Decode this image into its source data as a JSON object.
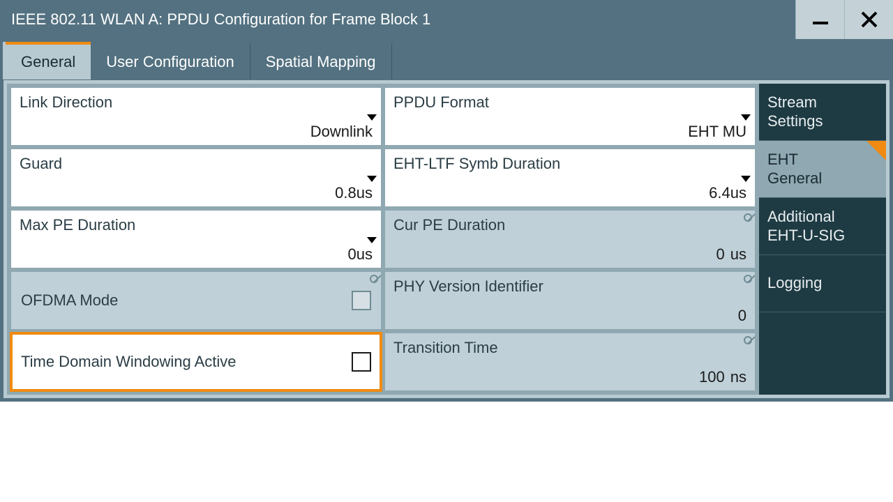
{
  "title": "IEEE 802.11 WLAN  A: PPDU Configuration for Frame Block 1",
  "tabs": [
    {
      "label": "General"
    },
    {
      "label": "User Configuration"
    },
    {
      "label": "Spatial Mapping"
    }
  ],
  "fields": {
    "link_direction": {
      "label": "Link Direction",
      "value": "Downlink"
    },
    "ppdu_format": {
      "label": "PPDU Format",
      "value": "EHT MU"
    },
    "guard": {
      "label": "Guard",
      "value": "0.8us"
    },
    "eht_ltf": {
      "label": "EHT-LTF Symb Duration",
      "value": "6.4us"
    },
    "max_pe": {
      "label": "Max PE Duration",
      "value": "0us"
    },
    "cur_pe": {
      "label": "Cur PE Duration",
      "value": "0",
      "unit": "us"
    },
    "ofdma": {
      "label": "OFDMA Mode"
    },
    "phy_ver": {
      "label": "PHY Version Identifier",
      "value": "0"
    },
    "tdwa": {
      "label": "Time Domain Windowing Active"
    },
    "transition": {
      "label": "Transition Time",
      "value": "100",
      "unit": "ns"
    }
  },
  "side": [
    {
      "l1": "Stream",
      "l2": "Settings"
    },
    {
      "l1": "EHT",
      "l2": "General"
    },
    {
      "l1": "Additional",
      "l2": "EHT-U-SIG"
    },
    {
      "l1": "Logging",
      "l2": ""
    }
  ]
}
